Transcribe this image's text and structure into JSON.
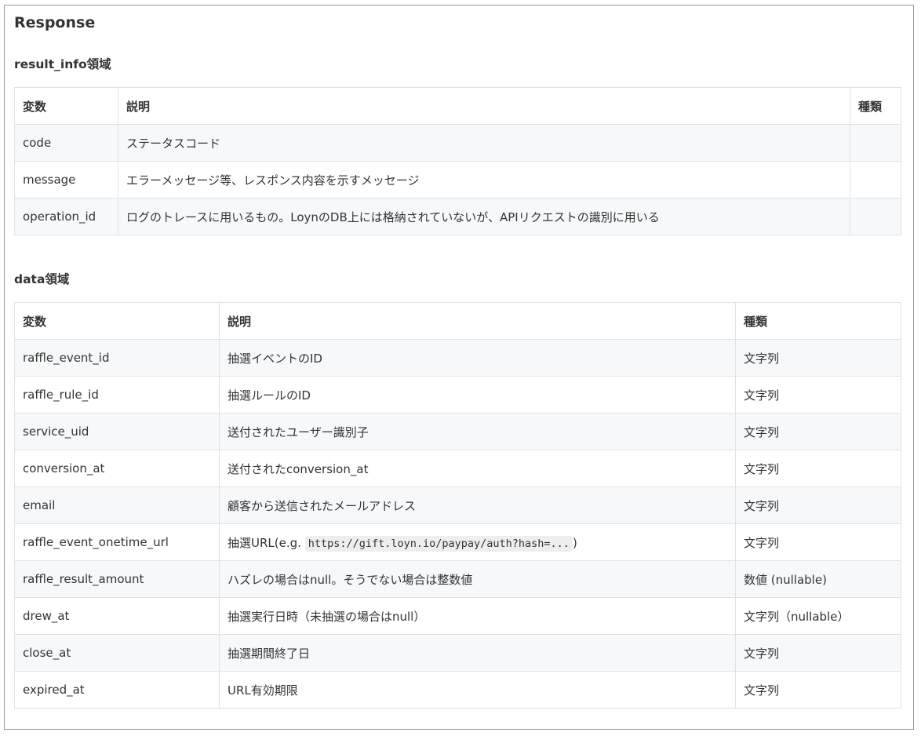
{
  "title": "Response",
  "result_info": {
    "heading": "result_info領域",
    "columns": [
      "変数",
      "説明",
      "種類"
    ],
    "rows": [
      {
        "variable": "code",
        "description": "ステータスコード",
        "type": ""
      },
      {
        "variable": "message",
        "description": "エラーメッセージ等、レスポンス内容を示すメッセージ",
        "type": ""
      },
      {
        "variable": "operation_id",
        "description": "ログのトレースに用いるもの。LoynのDB上には格納されていないが、APIリクエストの識別に用いる",
        "type": ""
      }
    ]
  },
  "data": {
    "heading": "data領域",
    "columns": [
      "変数",
      "説明",
      "種類"
    ],
    "rows": [
      {
        "variable": "raffle_event_id",
        "description": "抽選イベントのID",
        "type": "文字列"
      },
      {
        "variable": "raffle_rule_id",
        "description": "抽選ルールのID",
        "type": "文字列"
      },
      {
        "variable": "service_uid",
        "description": "送付されたユーザー識別子",
        "type": "文字列"
      },
      {
        "variable": "conversion_at",
        "description": "送付されたconversion_at",
        "type": "文字列"
      },
      {
        "variable": "email",
        "description": "顧客から送信されたメールアドレス",
        "type": "文字列"
      },
      {
        "variable": "raffle_event_onetime_url",
        "description_prefix": "抽選URL(e.g.",
        "description_code": "https://gift.loyn.io/paypay/auth?hash=...",
        "description_suffix": ")",
        "type": "文字列"
      },
      {
        "variable": "raffle_result_amount",
        "description": "ハズレの場合はnull。そうでない場合は整数値",
        "type": "数値 (nullable)"
      },
      {
        "variable": "drew_at",
        "description": "抽選実行日時（未抽選の場合はnull）",
        "type": "文字列（nullable）"
      },
      {
        "variable": "close_at",
        "description": "抽選期間終了日",
        "type": "文字列"
      },
      {
        "variable": "expired_at",
        "description": "URL有効期限",
        "type": "文字列"
      }
    ]
  }
}
